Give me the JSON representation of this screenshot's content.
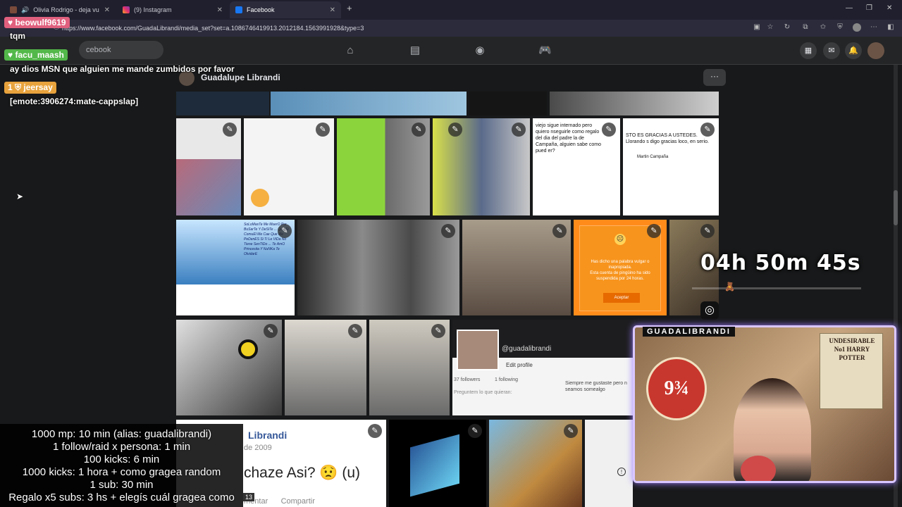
{
  "tabs": [
    {
      "title": "Olivia Rodrigo - deja vu (Offic",
      "icon": "speaker-icon",
      "active": false
    },
    {
      "title": "(9) Instagram",
      "icon": "instagram-icon",
      "active": false
    },
    {
      "title": "Facebook",
      "icon": "facebook-icon",
      "active": true
    }
  ],
  "address_bar": {
    "url": "https://www.facebook.com/GuadaLibrandi/media_set?set=a.1086746419913.2012184.1563991928&type=3"
  },
  "facebook": {
    "search_text": "cebook",
    "profile_name": "Guadalupe Librandi",
    "more_label": "···"
  },
  "grid": {
    "post_name": "Librandi",
    "post_date": "de 2009",
    "post_text": "chaze Asi? 😟 (u)",
    "post_actions": "mentar      Compartir",
    "ig_handle": "@guadalibrandi",
    "ig_edit": "Edit profile",
    "ig_followers": "37 followers",
    "ig_following": "1 following",
    "ig_comment": "Siempre me gustaste pero n seamos somealgo",
    "ig_ask": "Preguntem lo que quieran:",
    "tweet_martin": "Martin Campaña",
    "tweet_gracias": "STO ES GRACIAS A USTEDES. Llorando s digo gracias loco, en serio.",
    "tweet_viejo": "viejo sigue internado pero quiero nseguirle como regalo del dia del padre la de Campaña, alguien sabe como pued er?",
    "alert_title": "Has dicho una palabra vulgar o inapropiada.",
    "alert_body": "Esta cuenta de pingüino ha sido suspendida por 24 horas.",
    "alert_button": "Aceptar",
    "sorry_card": "SoLoMasTe Me MuerO Por BuSarTe Y DeSiTe ... Que Si ComuEl Me Cae Que Me PeDenES Si Ti Le ViDa No Tiene SenTiDo ... Te AmO Princesita Y NuNKa Te OlvidarE"
  },
  "chat": [
    {
      "user": "beowulf9619",
      "message": "tqm",
      "color": "#e0607e"
    },
    {
      "user": "facu_maash",
      "message": "ay dios MSN que alguien me mande zumbidos por favor",
      "color": "#53b84a"
    },
    {
      "user": "jeersay",
      "badge": "1",
      "message": "[emote:3906274:mate-cappslap]",
      "color": "#e8a33d"
    }
  ],
  "goals": [
    "1000 mp: 10 min (alias: guadalibrandi)",
    "1 follow/raid x persona: 1 min",
    "100 kicks: 6 min",
    "1000 kicks: 1 hora + como gragea random",
    "1 sub: 30 min",
    "Regalo x5 subs: 3 hs + elegís cuál gragea como"
  ],
  "goal_badge": "13",
  "timer": "04h 50m 45s",
  "webcam": {
    "title": "GUADALIBRANDI",
    "poster": "UNDESIRABLE No1 HARRY POTTER",
    "platform": "9¾"
  },
  "colors": {
    "fb_bg": "#18191a",
    "fb_nav": "#242526",
    "accent": "#d9c6ff",
    "browser": "#1f1f2e"
  }
}
